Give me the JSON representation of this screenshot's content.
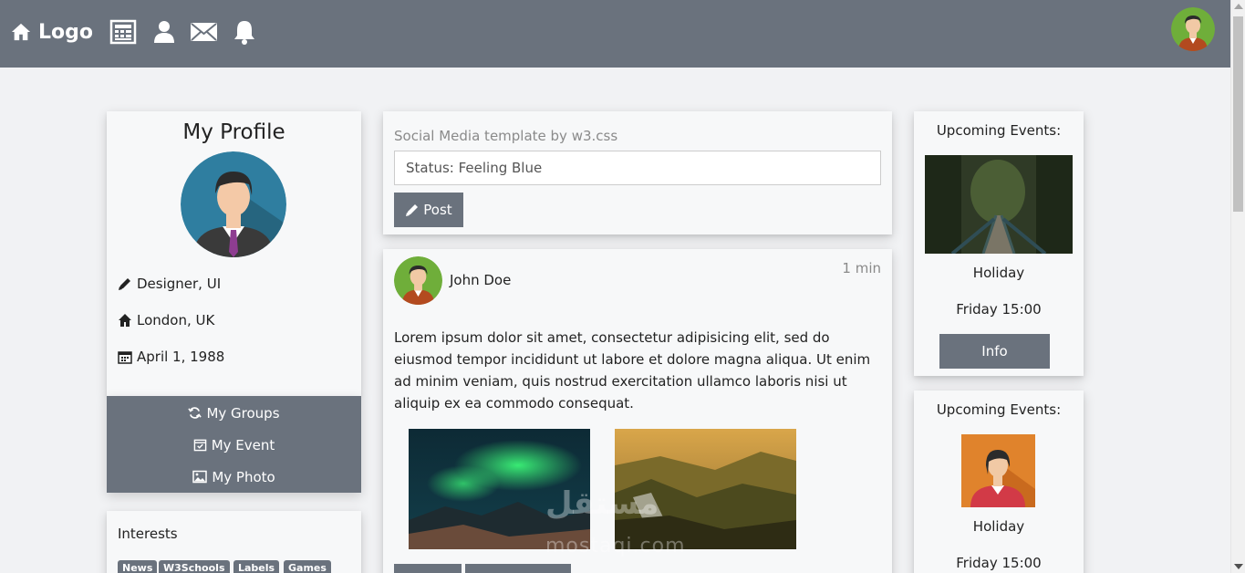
{
  "nav": {
    "logo_label": "Logo",
    "icons": [
      "home-icon",
      "news-icon",
      "user-icon",
      "envelope-icon",
      "bell-icon"
    ]
  },
  "profile": {
    "title": "My Profile",
    "job": "Designer, UI",
    "location": "London, UK",
    "birthday": "April 1, 1988",
    "menu": [
      {
        "label": "My Groups",
        "icon": "refresh-icon"
      },
      {
        "label": "My Event",
        "icon": "calendar-check-icon"
      },
      {
        "label": "My Photo",
        "icon": "photo-icon"
      }
    ],
    "interests_title": "Interests",
    "tags": [
      "News",
      "W3Schools",
      "Labels",
      "Games"
    ]
  },
  "status": {
    "heading": "Social Media template by w3.css",
    "input_value": "Status: Feeling Blue",
    "post_label": "Post"
  },
  "post": {
    "author": "John Doe",
    "time": "1 min",
    "text": "Lorem ipsum dolor sit amet, consectetur adipisicing elit, sed do eiusmod tempor incididunt ut labore et dolore magna aliqua. Ut enim ad minim veniam, quis nostrud exercitation ullamco laboris nisi ut aliquip ex ea commodo consequat."
  },
  "events": [
    {
      "title": "Upcoming Events:",
      "name": "Holiday",
      "time": "Friday 15:00",
      "button": "Info"
    },
    {
      "title": "Upcoming Events:",
      "name": "Holiday",
      "time": "Friday 15:00"
    }
  ],
  "colors": {
    "nav": "#6a727d",
    "page": "#f1f2f4",
    "card": "#f7f8f9"
  },
  "watermark": {
    "arabic": "مستقل",
    "latin": "mostaqi.com"
  }
}
